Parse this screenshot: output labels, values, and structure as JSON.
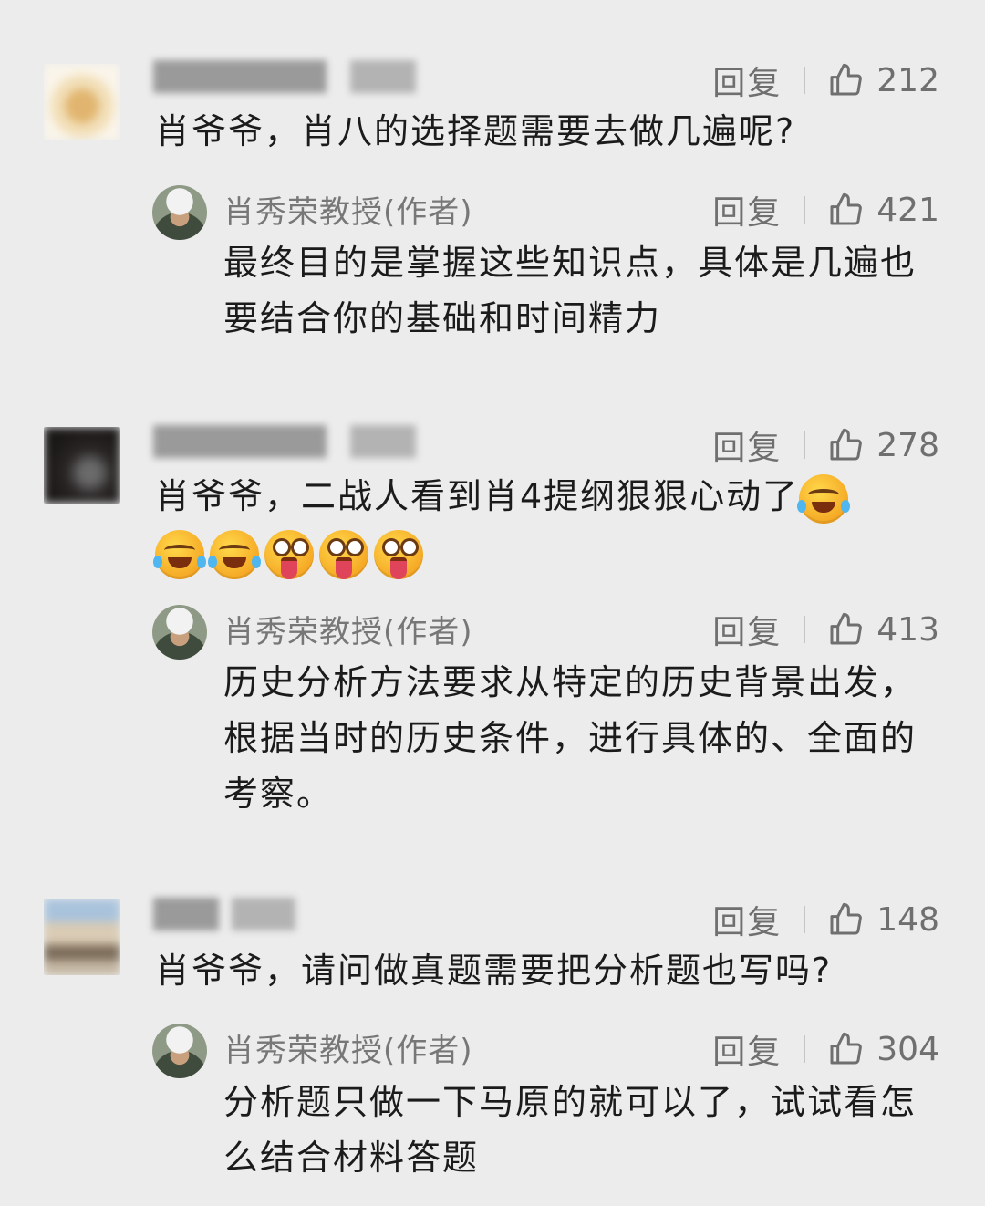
{
  "threads": [
    {
      "comment": {
        "username": "",
        "text": "肖爷爷，肖八的选择题需要去做几遍呢?",
        "reply_label": "回复",
        "likes": "212"
      },
      "reply": {
        "author": "肖秀荣教授(作者)",
        "text": "最终目的是掌握这些知识点，具体是几遍也要结合你的基础和时间精力",
        "reply_label": "回复",
        "likes": "421"
      }
    },
    {
      "comment": {
        "username": "",
        "text": "肖爷爷，二战人看到肖4提纲狠狠心动了",
        "emojis": [
          "laugh-tears",
          "laugh-tears",
          "laugh-tears",
          "tongue-out",
          "tongue-out",
          "tongue-out"
        ],
        "reply_label": "回复",
        "likes": "278"
      },
      "reply": {
        "author": "肖秀荣教授(作者)",
        "text": "历史分析方法要求从特定的历史背景出发，根据当时的历史条件，进行具体的、全面的考察。",
        "reply_label": "回复",
        "likes": "413"
      }
    },
    {
      "comment": {
        "username": "",
        "text": "肖爷爷，请问做真题需要把分析题也写吗?",
        "reply_label": "回复",
        "likes": "148"
      },
      "reply": {
        "author": "肖秀荣教授(作者)",
        "text": "分析题只做一下马原的就可以了，试试看怎么结合材料答题",
        "reply_label": "回复",
        "likes": "304"
      }
    }
  ],
  "colors": {
    "background": "#ececec",
    "text": "#1b1b1b",
    "muted": "#6f6f6f"
  }
}
